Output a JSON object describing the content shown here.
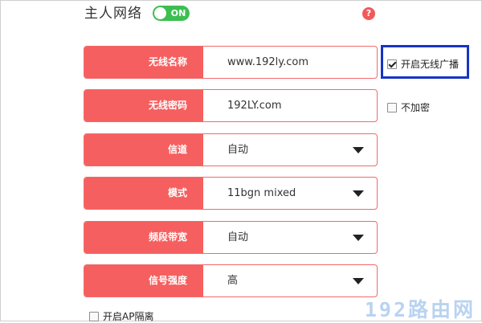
{
  "section": {
    "title": "主人网络",
    "toggle_label": "ON",
    "toggle_on": true,
    "help_icon": "question-icon"
  },
  "fields": {
    "ssid": {
      "label": "无线名称",
      "value": "www.192ly.com"
    },
    "password": {
      "label": "无线密码",
      "value": "192LY.com"
    },
    "channel": {
      "label": "信道",
      "value": "自动"
    },
    "mode": {
      "label": "模式",
      "value": "11bgn mixed"
    },
    "bandwidth": {
      "label": "频段带宽",
      "value": "自动"
    },
    "power": {
      "label": "信号强度",
      "value": "高"
    }
  },
  "options": {
    "broadcast": {
      "label": "开启无线广播",
      "checked": true
    },
    "no_encrypt": {
      "label": "不加密",
      "checked": false
    },
    "ap_isolation": {
      "label": "开启AP隔离",
      "checked": false
    }
  },
  "watermark": "192路由网",
  "colors": {
    "accent": "#f65f5f",
    "toggle_on": "#3cbf50",
    "highlight": "#1634c7"
  }
}
